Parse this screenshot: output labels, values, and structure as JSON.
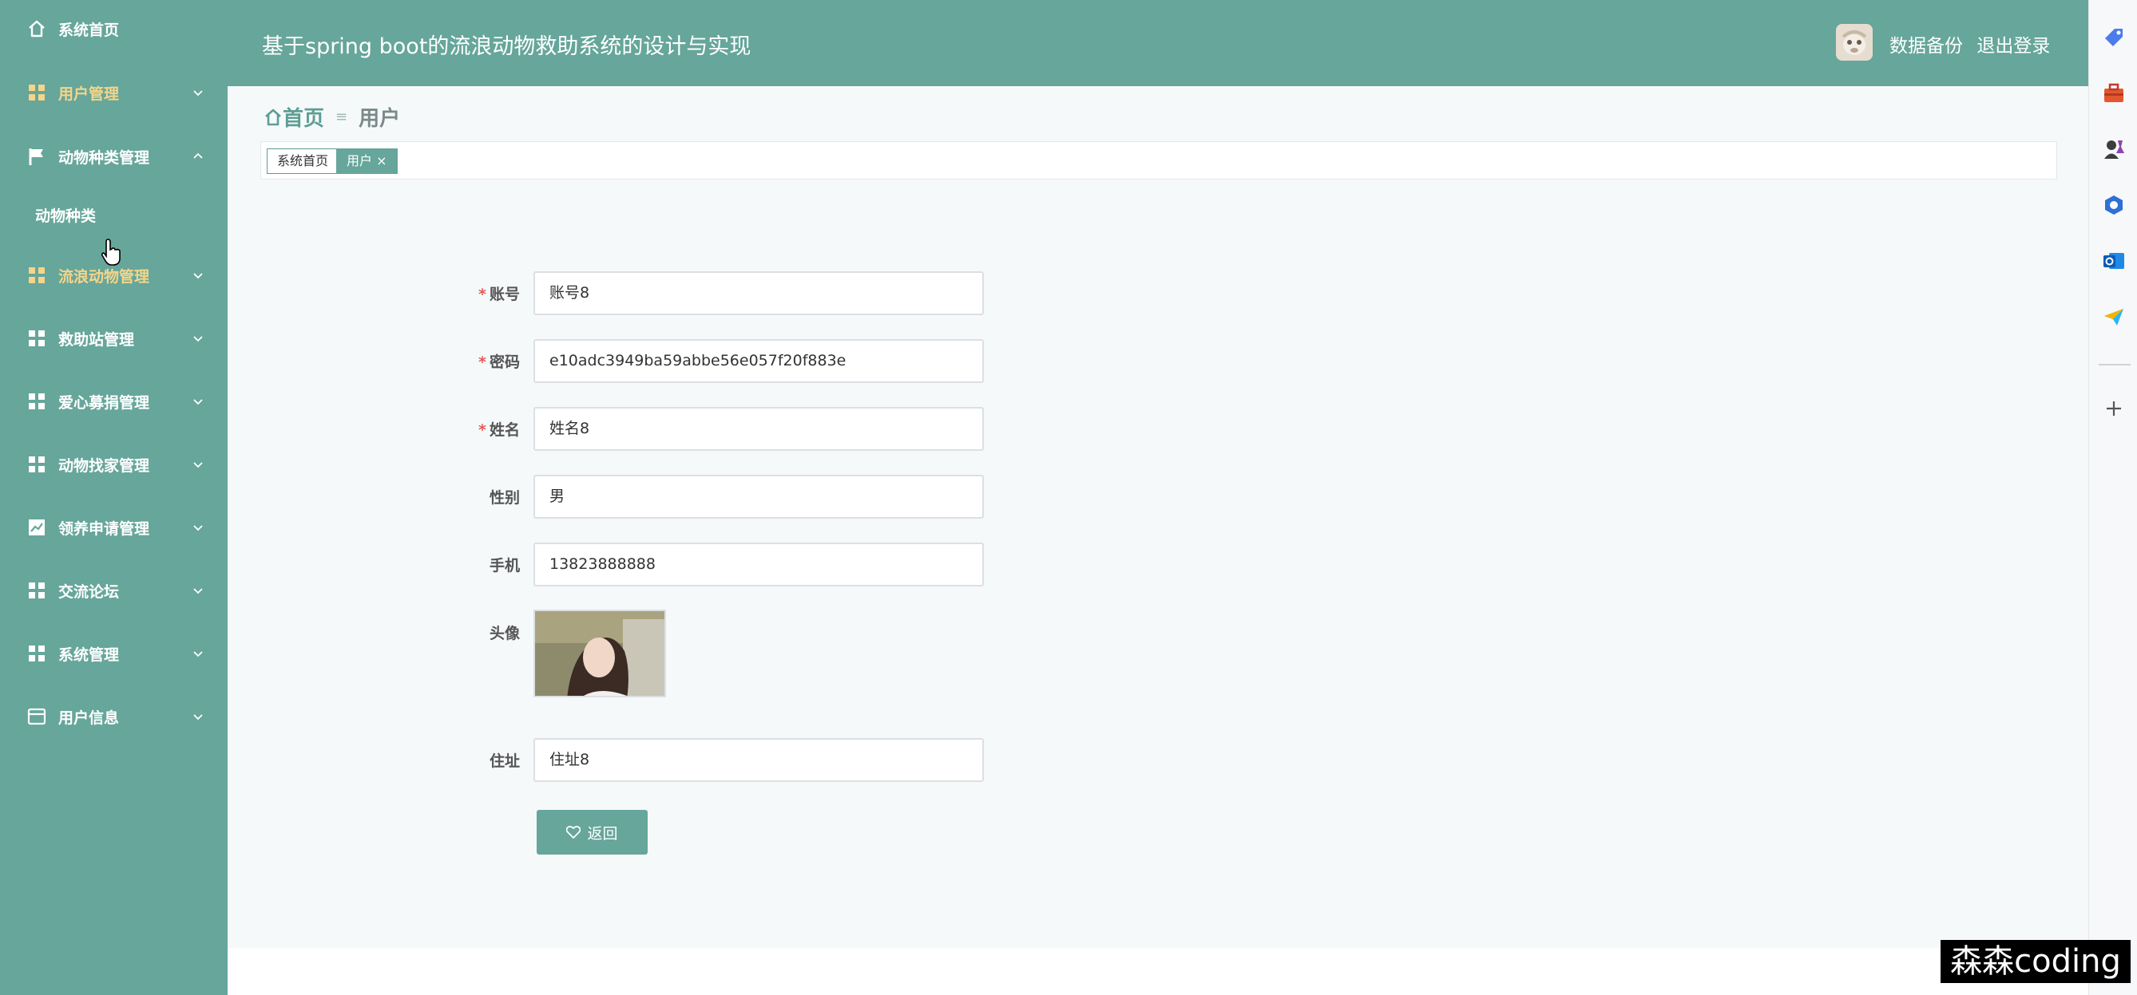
{
  "header": {
    "title": "基于spring boot的流浪动物救助系统的设计与实现",
    "backup_link": "数据备份",
    "logout_link": "退出登录"
  },
  "sidebar": {
    "items": [
      {
        "label": "系统首页",
        "icon": "home-icon"
      },
      {
        "label": "用户管理",
        "icon": "grid-icon"
      },
      {
        "label": "动物种类管理",
        "icon": "flag-icon",
        "expanded": true
      },
      {
        "label": "流浪动物管理",
        "icon": "grid-icon"
      },
      {
        "label": "救助站管理",
        "icon": "grid-icon"
      },
      {
        "label": "爱心募捐管理",
        "icon": "grid-icon"
      },
      {
        "label": "动物找家管理",
        "icon": "grid-icon"
      },
      {
        "label": "领养申请管理",
        "icon": "chart-icon"
      },
      {
        "label": "交流论坛",
        "icon": "grid-icon"
      },
      {
        "label": "系统管理",
        "icon": "grid-icon"
      },
      {
        "label": "用户信息",
        "icon": "card-icon"
      }
    ],
    "subitem": "动物种类"
  },
  "breadcrumb": {
    "home": "首页",
    "current": "用户"
  },
  "tags": {
    "home": "系统首页",
    "active": "用户 ×"
  },
  "form": {
    "account_label": "账号",
    "account_value": "账号8",
    "password_label": "密码",
    "password_value": "e10adc3949ba59abbe56e057f20f883e",
    "name_label": "姓名",
    "name_value": "姓名8",
    "gender_label": "性别",
    "gender_value": "男",
    "phone_label": "手机",
    "phone_value": "13823888888",
    "avatar_label": "头像",
    "address_label": "住址",
    "address_value": "住址8",
    "back_button": "返回"
  },
  "watermark": "森森coding",
  "colors": {
    "primary": "#66a69b",
    "highlight": "#f4d58a",
    "required": "#e15b5b"
  }
}
